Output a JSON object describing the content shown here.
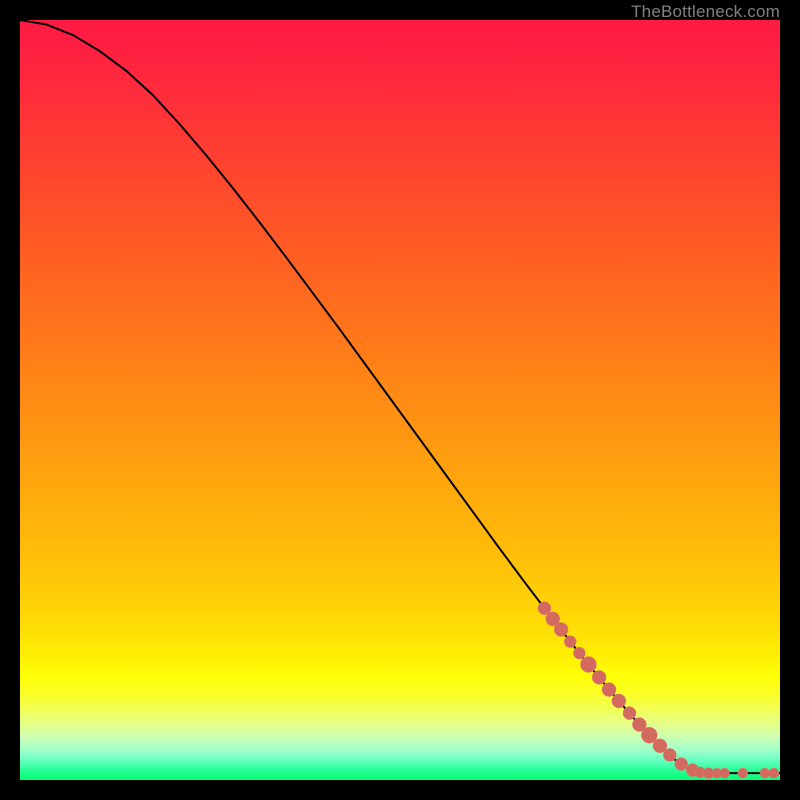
{
  "watermark": "TheBottleneck.com",
  "colors": {
    "marker_fill": "#d46a5f",
    "marker_stroke": "#e07a70",
    "curve_stroke": "#000000"
  },
  "chart_data": {
    "type": "line",
    "title": "",
    "xlabel": "",
    "ylabel": "",
    "xlim": [
      0,
      100
    ],
    "ylim": [
      0,
      100
    ],
    "grid": false,
    "legend": false,
    "curve": [
      {
        "x": 0.0,
        "y": 100.0
      },
      {
        "x": 3.5,
        "y": 99.4
      },
      {
        "x": 7.0,
        "y": 98.0
      },
      {
        "x": 10.5,
        "y": 95.9
      },
      {
        "x": 14.0,
        "y": 93.3
      },
      {
        "x": 17.5,
        "y": 90.1
      },
      {
        "x": 21.0,
        "y": 86.3
      },
      {
        "x": 24.5,
        "y": 82.2
      },
      {
        "x": 28.0,
        "y": 77.9
      },
      {
        "x": 31.5,
        "y": 73.4
      },
      {
        "x": 35.0,
        "y": 68.8
      },
      {
        "x": 38.5,
        "y": 64.1
      },
      {
        "x": 42.0,
        "y": 59.4
      },
      {
        "x": 45.5,
        "y": 54.6
      },
      {
        "x": 49.0,
        "y": 49.8
      },
      {
        "x": 52.5,
        "y": 45.0
      },
      {
        "x": 56.0,
        "y": 40.2
      },
      {
        "x": 59.5,
        "y": 35.4
      },
      {
        "x": 63.0,
        "y": 30.6
      },
      {
        "x": 66.5,
        "y": 25.9
      },
      {
        "x": 70.0,
        "y": 21.3
      },
      {
        "x": 73.5,
        "y": 16.8
      },
      {
        "x": 77.0,
        "y": 12.5
      },
      {
        "x": 80.5,
        "y": 8.4
      },
      {
        "x": 84.0,
        "y": 4.7
      },
      {
        "x": 86.0,
        "y": 2.8
      },
      {
        "x": 87.5,
        "y": 1.7
      },
      {
        "x": 88.8,
        "y": 1.1
      },
      {
        "x": 90.0,
        "y": 0.9
      },
      {
        "x": 92.0,
        "y": 0.9
      },
      {
        "x": 95.0,
        "y": 0.9
      },
      {
        "x": 100.0,
        "y": 0.9
      }
    ],
    "markers": [
      {
        "x": 69.0,
        "y": 22.6,
        "r": 6.5
      },
      {
        "x": 70.1,
        "y": 21.2,
        "r": 7.0
      },
      {
        "x": 71.2,
        "y": 19.8,
        "r": 7.0
      },
      {
        "x": 72.4,
        "y": 18.2,
        "r": 6.0
      },
      {
        "x": 73.6,
        "y": 16.7,
        "r": 6.0
      },
      {
        "x": 74.8,
        "y": 15.2,
        "r": 8.0
      },
      {
        "x": 76.2,
        "y": 13.5,
        "r": 7.0
      },
      {
        "x": 77.5,
        "y": 11.9,
        "r": 7.0
      },
      {
        "x": 78.8,
        "y": 10.4,
        "r": 7.0
      },
      {
        "x": 80.2,
        "y": 8.8,
        "r": 6.5
      },
      {
        "x": 81.5,
        "y": 7.3,
        "r": 7.0
      },
      {
        "x": 82.8,
        "y": 5.9,
        "r": 8.0
      },
      {
        "x": 84.2,
        "y": 4.5,
        "r": 7.0
      },
      {
        "x": 85.5,
        "y": 3.3,
        "r": 6.5
      },
      {
        "x": 87.0,
        "y": 2.1,
        "r": 6.5
      },
      {
        "x": 88.5,
        "y": 1.3,
        "r": 6.5
      },
      {
        "x": 89.5,
        "y": 1.0,
        "r": 5.5
      },
      {
        "x": 90.6,
        "y": 0.9,
        "r": 5.5
      },
      {
        "x": 91.7,
        "y": 0.9,
        "r": 5.0
      },
      {
        "x": 92.7,
        "y": 0.9,
        "r": 5.0
      },
      {
        "x": 95.1,
        "y": 0.9,
        "r": 5.0
      },
      {
        "x": 98.0,
        "y": 0.9,
        "r": 5.0
      },
      {
        "x": 99.2,
        "y": 0.9,
        "r": 5.0
      }
    ]
  }
}
